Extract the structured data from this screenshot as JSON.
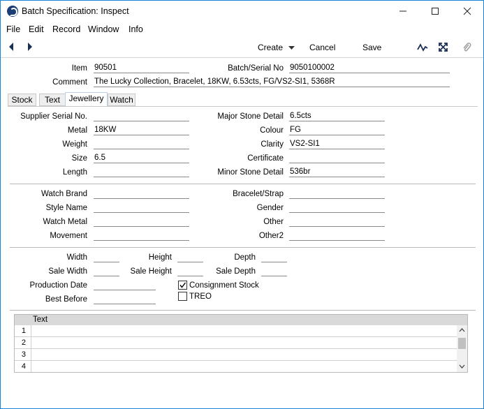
{
  "window": {
    "title": "Batch Specification: Inspect"
  },
  "menu": [
    "File",
    "Edit",
    "Record",
    "Window",
    "Info"
  ],
  "toolbar": {
    "create": "Create",
    "cancel": "Cancel",
    "save": "Save"
  },
  "header": {
    "item_label": "Item",
    "item_value": "90501",
    "batch_label": "Batch/Serial No",
    "batch_value": "9050100002",
    "comment_label": "Comment",
    "comment_value": "The Lucky Collection, Bracelet, 18KW, 6.53cts, FG/VS2-SI1, 5368R"
  },
  "tabs": [
    "Stock",
    "Text",
    "Jewellery",
    "Watch"
  ],
  "active_tab": "Jewellery",
  "jewellery": {
    "left": [
      {
        "label": "Supplier Serial No.",
        "value": ""
      },
      {
        "label": "Metal",
        "value": "18KW"
      },
      {
        "label": "Weight",
        "value": ""
      },
      {
        "label": "Size",
        "value": "6.5"
      },
      {
        "label": "Length",
        "value": ""
      }
    ],
    "right": [
      {
        "label": "Major Stone Detail",
        "value": "6.5cts"
      },
      {
        "label": "Colour",
        "value": "FG"
      },
      {
        "label": "Clarity",
        "value": "VS2-SI1"
      },
      {
        "label": "Certificate",
        "value": ""
      },
      {
        "label": "Minor Stone Detail",
        "value": "536br"
      }
    ]
  },
  "watch": {
    "left": [
      {
        "label": "Watch Brand",
        "value": ""
      },
      {
        "label": "Style Name",
        "value": ""
      },
      {
        "label": "Watch Metal",
        "value": ""
      },
      {
        "label": "Movement",
        "value": ""
      }
    ],
    "right": [
      {
        "label": "Bracelet/Strap",
        "value": ""
      },
      {
        "label": "Gender",
        "value": ""
      },
      {
        "label": "Other",
        "value": ""
      },
      {
        "label": "Other2",
        "value": ""
      }
    ]
  },
  "dimensions": {
    "width": "Width",
    "height": "Height",
    "depth": "Depth",
    "sale_width": "Sale Width",
    "sale_height": "Sale Height",
    "sale_depth": "Sale Depth",
    "production_date": "Production Date",
    "best_before": "Best Before",
    "consignment_stock": "Consignment Stock",
    "consignment_checked": true,
    "treo": "TREO",
    "treo_checked": false
  },
  "grid": {
    "header": "Text",
    "rows": [
      "1",
      "2",
      "3",
      "4"
    ]
  },
  "colors": {
    "accent": "#1883d7",
    "tab_border": "#b8cfe7"
  }
}
